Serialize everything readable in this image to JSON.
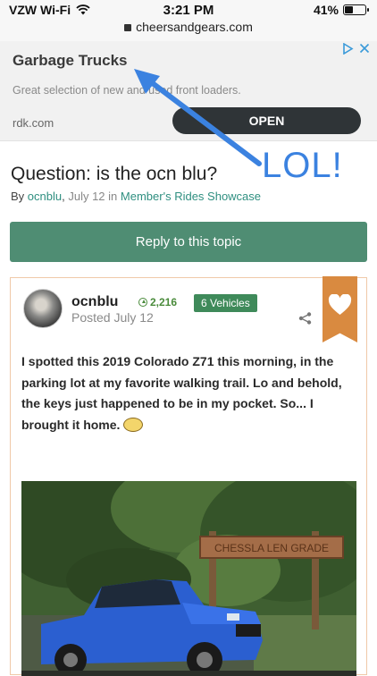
{
  "status_bar": {
    "carrier": "VZW Wi-Fi",
    "time": "3:21 PM",
    "battery": "41%",
    "battery_level": 0.41,
    "url": "cheersandgears.com"
  },
  "ad": {
    "title": "Garbage Trucks",
    "description": "Great selection of new and used front loaders.",
    "domain": "rdk.com",
    "open_label": "OPEN",
    "choices_icon": "adchoices-icon",
    "close_icon": "close-icon"
  },
  "annotation": {
    "text": "LOL!",
    "color": "#3b82e0"
  },
  "topic": {
    "title": "Question: is the ocn blu?",
    "by_prefix": "By",
    "author": "ocnblu",
    "date": "July 12",
    "in_word": "in",
    "forum": "Member's Rides Showcase",
    "reply_label": "Reply to this topic"
  },
  "post": {
    "author": "ocnblu",
    "reputation": "2,216",
    "vehicles_badge": "6 Vehicles",
    "posted": "Posted July 12",
    "body": "I spotted this 2019 Colorado Z71 this morning, in the parking lot at my favorite walking trail.  Lo and behold, the keys just happened to be in my pocket.  So... I brought it home.",
    "photo_sign_text": "CHESSLA LEN GRADE"
  },
  "colors": {
    "reply_button": "#4f8d73",
    "link": "#2f8f80",
    "bookmark": "#d98a40",
    "vehicles_badge": "#3f8a5a"
  }
}
